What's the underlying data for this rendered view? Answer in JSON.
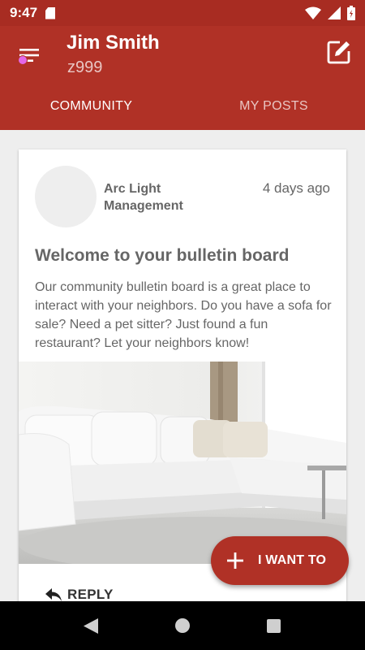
{
  "status_bar": {
    "time": "9:47",
    "icons": [
      "sd-card-icon",
      "wifi-icon",
      "signal-icon",
      "battery-icon"
    ]
  },
  "header": {
    "user_name": "Jim Smith",
    "user_code": "z999",
    "menu_icon": "menu-icon",
    "compose_icon": "compose-icon",
    "accent_color": "#b03126"
  },
  "tabs": [
    {
      "label": "COMMUNITY",
      "active": true
    },
    {
      "label": "MY POSTS",
      "active": false
    }
  ],
  "post": {
    "author": "Arc Light Management",
    "timestamp": "4 days ago",
    "title": "Welcome to your bulletin board",
    "body": "Our community bulletin board is a great place to interact with your neighbors.  Do you have a sofa for sale?  Need a pet sitter?  Just found a fun restaurant?  Let your neighbors know!",
    "reply_label": "REPLY"
  },
  "fab": {
    "label": "I WANT TO",
    "icon": "plus-icon"
  },
  "nav": {
    "icons": [
      "back-icon",
      "home-icon",
      "recents-icon"
    ]
  }
}
